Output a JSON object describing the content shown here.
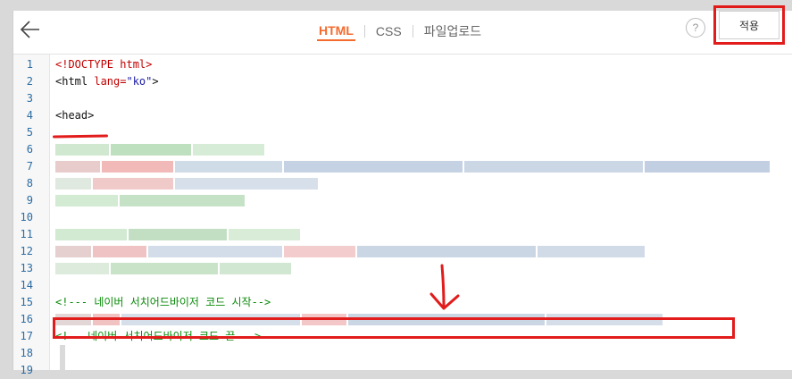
{
  "toolbar": {
    "back_icon": "left-arrow-icon",
    "tabs": [
      {
        "label": "HTML",
        "active": true
      },
      {
        "label": "CSS",
        "active": false
      },
      {
        "label": "파일업로드",
        "active": false
      }
    ],
    "help_label": "?",
    "apply_label": "적용"
  },
  "editor": {
    "line_numbers": [
      "1",
      "2",
      "3",
      "4",
      "5",
      "6",
      "7",
      "8",
      "9",
      "10",
      "11",
      "12",
      "13",
      "14",
      "15",
      "16",
      "17",
      "18",
      "19"
    ],
    "lines": {
      "l1": "<!DOCTYPE html>",
      "l2_open": "<html ",
      "l2_attr": "lang=",
      "l2_val": "\"ko\"",
      "l2_close": ">",
      "l4": "<head>",
      "l15": "<!--- 네이버 서치어드바이저 코드 시작-->",
      "l17": "<!---네이버 서치어드바이저 코드 끝--->"
    }
  },
  "colors": {
    "accent": "#f46b2e",
    "annotation": "#e21b1b",
    "line_number": "#2b6ca3",
    "comment": "#0a8a0a"
  }
}
